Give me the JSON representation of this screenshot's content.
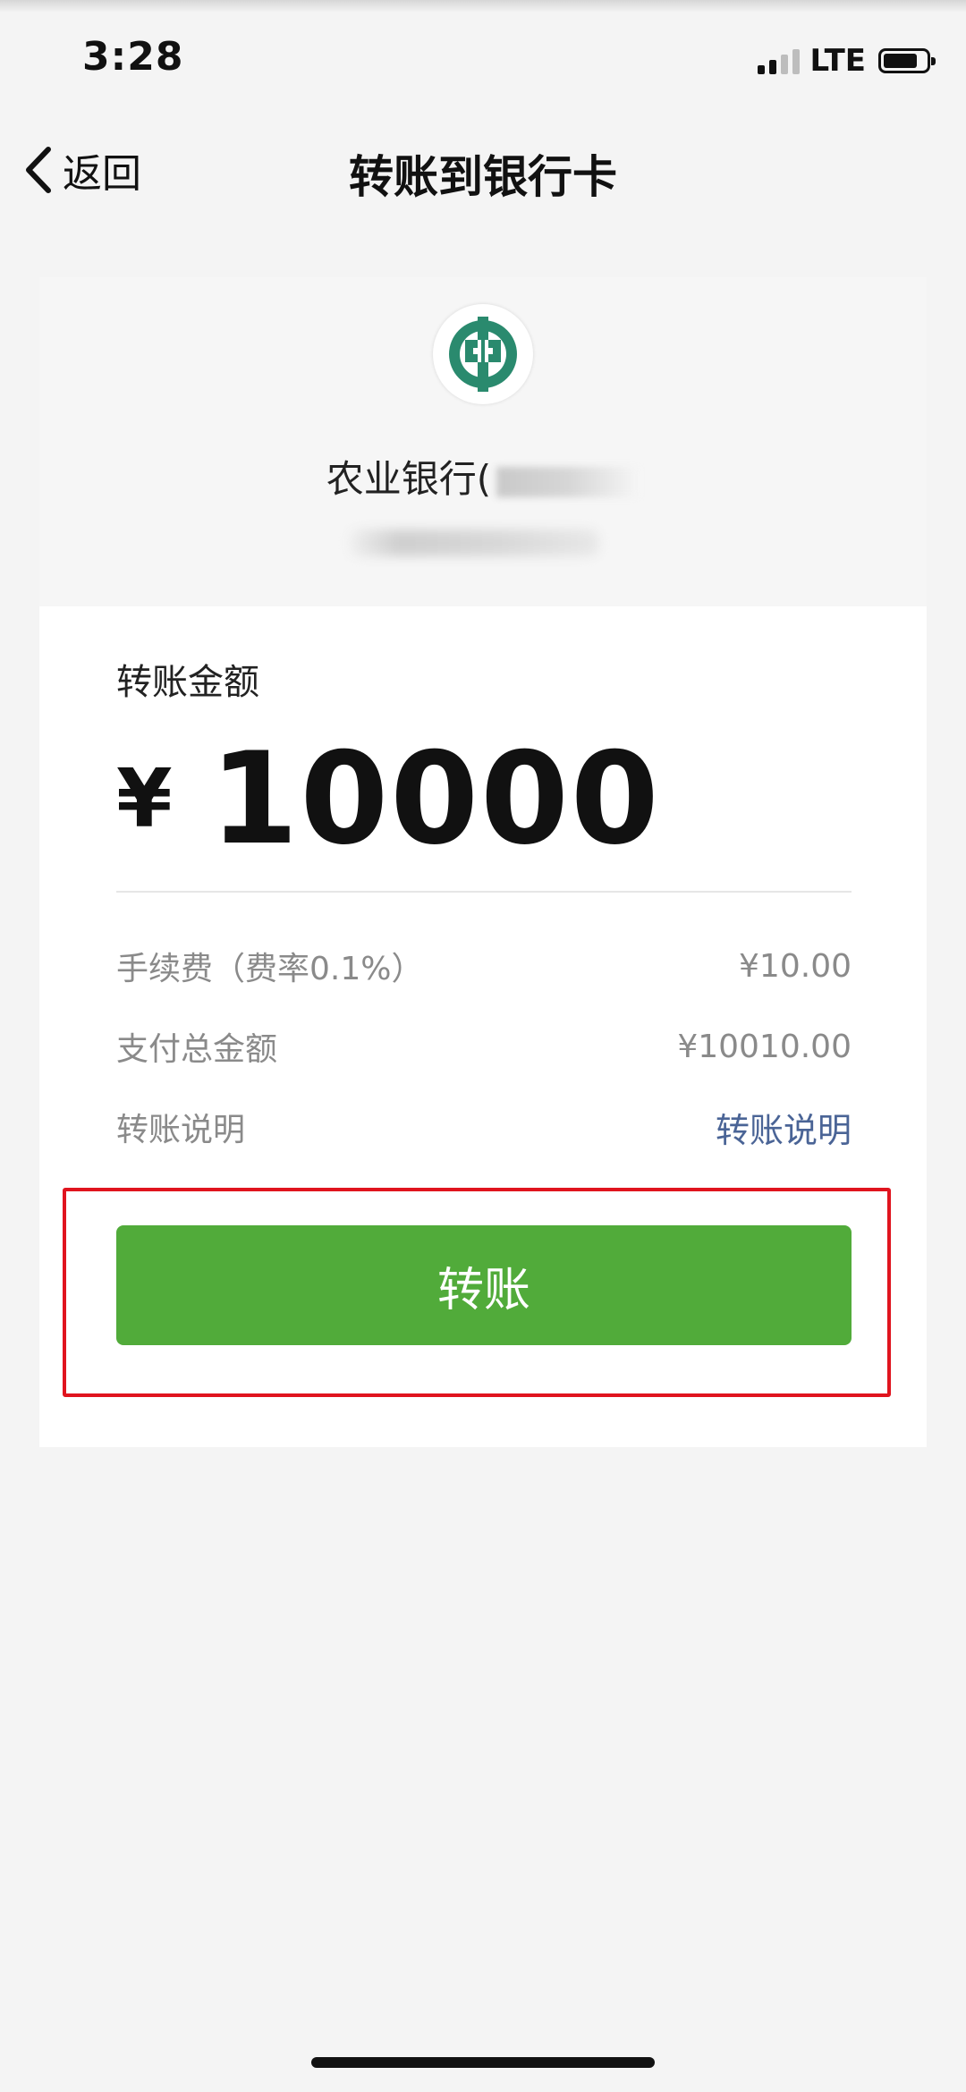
{
  "status_bar": {
    "time": "3:28",
    "network": "LTE",
    "battery_icon": "battery-icon",
    "signal_icon": "signal-icon"
  },
  "nav": {
    "back_label": "返回",
    "title": "转账到银行卡"
  },
  "bank": {
    "name": "农业银行(",
    "logo_icon": "abc-bank-logo-icon",
    "logo_color": "#2a8a6e"
  },
  "amount": {
    "label": "转账金额",
    "currency": "¥",
    "value": "10000"
  },
  "details": [
    {
      "label": "手续费（费率0.1%）",
      "value": "¥10.00"
    },
    {
      "label": "支付总金额",
      "value": "¥10010.00"
    },
    {
      "label": "转账说明",
      "value": "转账说明"
    }
  ],
  "action": {
    "label": "转账",
    "color": "#51ab3a",
    "highlight_color": "#e0141e"
  }
}
